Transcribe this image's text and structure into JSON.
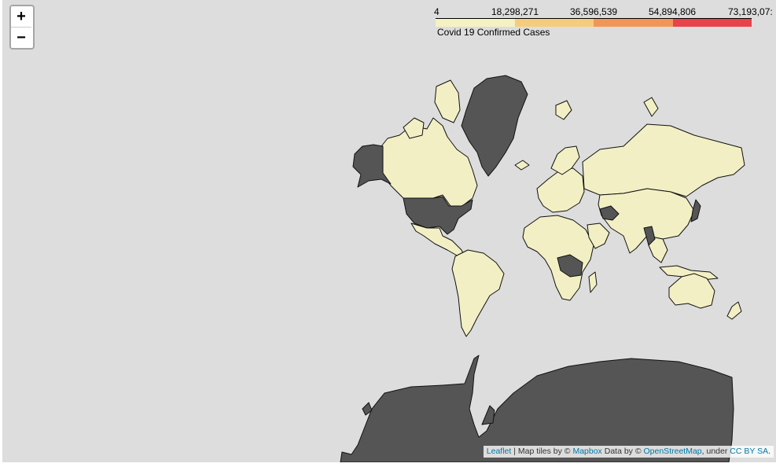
{
  "zoom": {
    "zoom_in_label": "+",
    "zoom_out_label": "−"
  },
  "legend": {
    "title": "Covid 19 Confirmed Cases",
    "ticks": [
      "4",
      "18,298,271",
      "36,596,539",
      "54,894,806",
      "73,193,07:"
    ],
    "ramp_colors": [
      "#f5f1c2",
      "#f5cc7d",
      "#f29657",
      "#e8434a"
    ]
  },
  "map": {
    "colors": {
      "background": "#dddddd",
      "low_cases_fill": "#f2efc4",
      "no_data_fill": "#555555",
      "border": "#111111"
    }
  },
  "attribution": {
    "leaflet": "Leaflet",
    "separator": " | Map tiles by © ",
    "mapbox": "Mapbox",
    "data_by": " Data by © ",
    "osm": "OpenStreetMap",
    "under": ", under ",
    "license": "CC BY SA",
    "end": "."
  }
}
